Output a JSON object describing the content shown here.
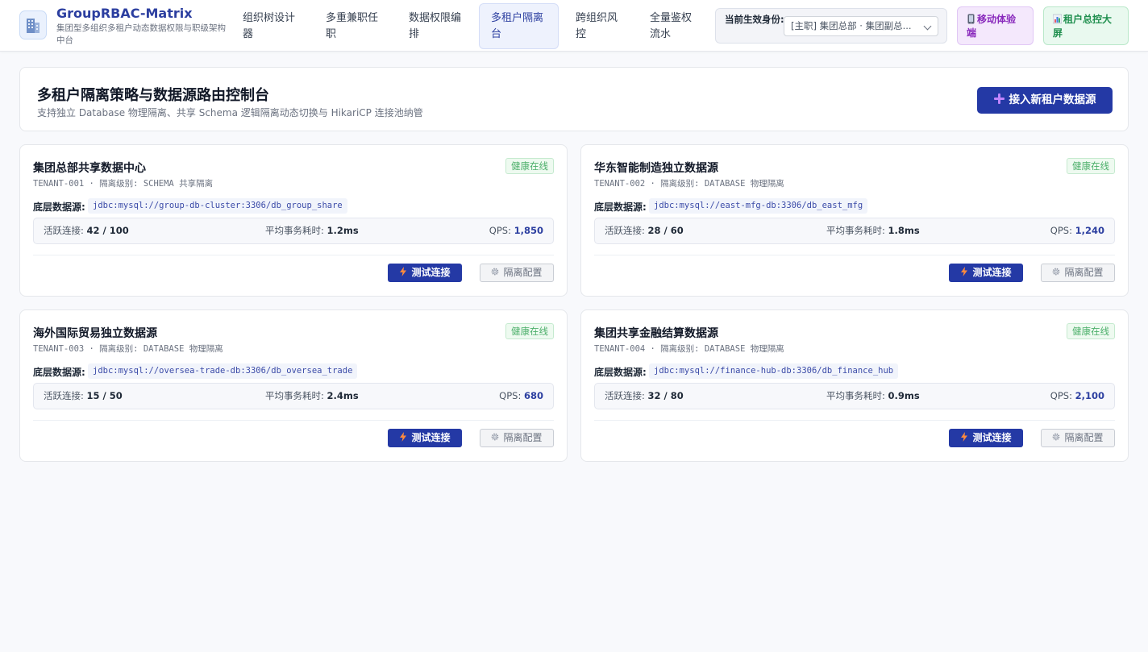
{
  "header": {
    "brand_title": "GroupRBAC-Matrix",
    "brand_subtitle": "集团型多组织多租户动态数据权限与职级架构中台",
    "logo_icon": "building-icon",
    "nav": [
      {
        "label": "组织树设计器"
      },
      {
        "label": "多重兼职任职"
      },
      {
        "label": "数据权限编排"
      },
      {
        "label": "多租户隔离台"
      },
      {
        "label": "跨组织风控"
      },
      {
        "label": "全量鉴权流水"
      }
    ],
    "active_nav_index": 3,
    "identity": {
      "label": "当前生效身份:",
      "value": "[主职] 集团总部 · 集团副总..."
    },
    "mobile_button": {
      "label": "移动体验端",
      "icon": "mobile-phone-icon",
      "color": "#8a2bbd"
    },
    "bigscreen_button": {
      "label": "租户总控大屏",
      "icon": "bar-chart-icon",
      "color": "#1f8f4e"
    }
  },
  "page": {
    "title": "多租户隔离策略与数据源路由控制台",
    "subtitle": "支持独立 Database 物理隔离、共享 Schema 逻辑隔离动态切换与 HikariCP 连接池纳管",
    "add_button_label": "接入新租户数据源",
    "add_button_icon": "plus-icon"
  },
  "labels": {
    "datasource": "底层数据源:",
    "active_conn": "活跃连接:",
    "avg_tx": "平均事务耗时:",
    "qps": "QPS:",
    "test_button": "测试连接",
    "config_button": "隔离配置"
  },
  "tenants": [
    {
      "name": "集团总部共享数据中心",
      "meta": "TENANT-001 · 隔离级别: SCHEMA 共享隔离",
      "status": "健康在线",
      "jdbc": "jdbc:mysql://group-db-cluster:3306/db_group_share",
      "active_conn": "42 / 100",
      "avg_tx": "1.2ms",
      "qps": "1,850"
    },
    {
      "name": "华东智能制造独立数据源",
      "meta": "TENANT-002 · 隔离级别: DATABASE 物理隔离",
      "status": "健康在线",
      "jdbc": "jdbc:mysql://east-mfg-db:3306/db_east_mfg",
      "active_conn": "28 / 60",
      "avg_tx": "1.8ms",
      "qps": "1,240"
    },
    {
      "name": "海外国际贸易独立数据源",
      "meta": "TENANT-003 · 隔离级别: DATABASE 物理隔离",
      "status": "健康在线",
      "jdbc": "jdbc:mysql://oversea-trade-db:3306/db_oversea_trade",
      "active_conn": "15 / 50",
      "avg_tx": "2.4ms",
      "qps": "680"
    },
    {
      "name": "集团共享金融结算数据源",
      "meta": "TENANT-004 · 隔离级别: DATABASE 物理隔离",
      "status": "健康在线",
      "jdbc": "jdbc:mysql://finance-hub-db:3306/db_finance_hub",
      "active_conn": "32 / 80",
      "avg_tx": "0.9ms",
      "qps": "2,100"
    }
  ],
  "colors": {
    "brand": "#2c3fa0",
    "primary_button": "#2439a5",
    "health_green": "#4caf6a",
    "background": "#f8f9fc"
  }
}
